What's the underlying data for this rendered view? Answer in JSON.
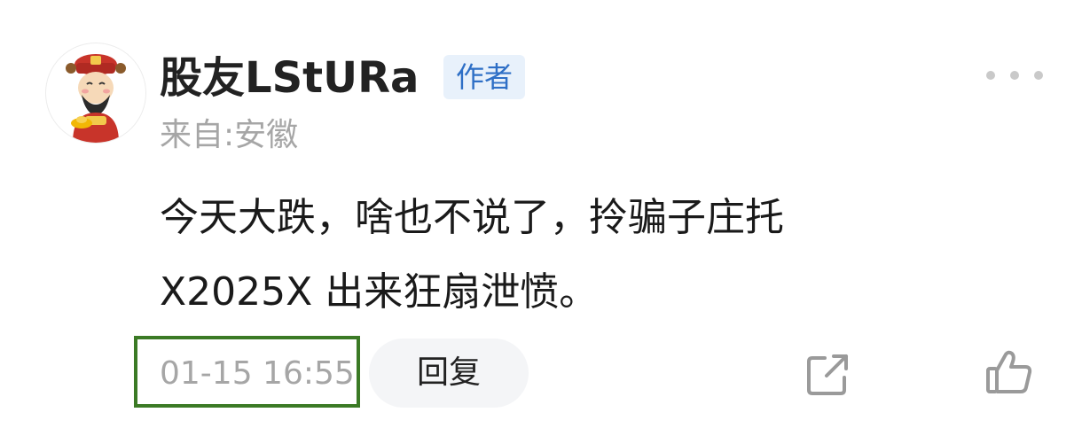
{
  "user": {
    "name": "股友LStURa",
    "badge": "作者",
    "location": "来自:安徽",
    "avatar_icon": "fortune-god-avatar"
  },
  "comment": {
    "lines": [
      "今天大跌，啥也不说了，拎骗子庄托",
      "X2025X 出来狂扇泄愤。"
    ],
    "timestamp": "01-15 16:55"
  },
  "actions": {
    "reply_label": "回复",
    "share_icon": "share-icon",
    "like_icon": "thumbs-up-icon",
    "more_icon": "more-dots-icon"
  },
  "colors": {
    "badge_bg": "#e8f1fb",
    "badge_text": "#2e6fc6",
    "highlight_box": "#3b7a25",
    "muted_text": "#a6a6a6",
    "icon_gray": "#9a9a9a"
  }
}
